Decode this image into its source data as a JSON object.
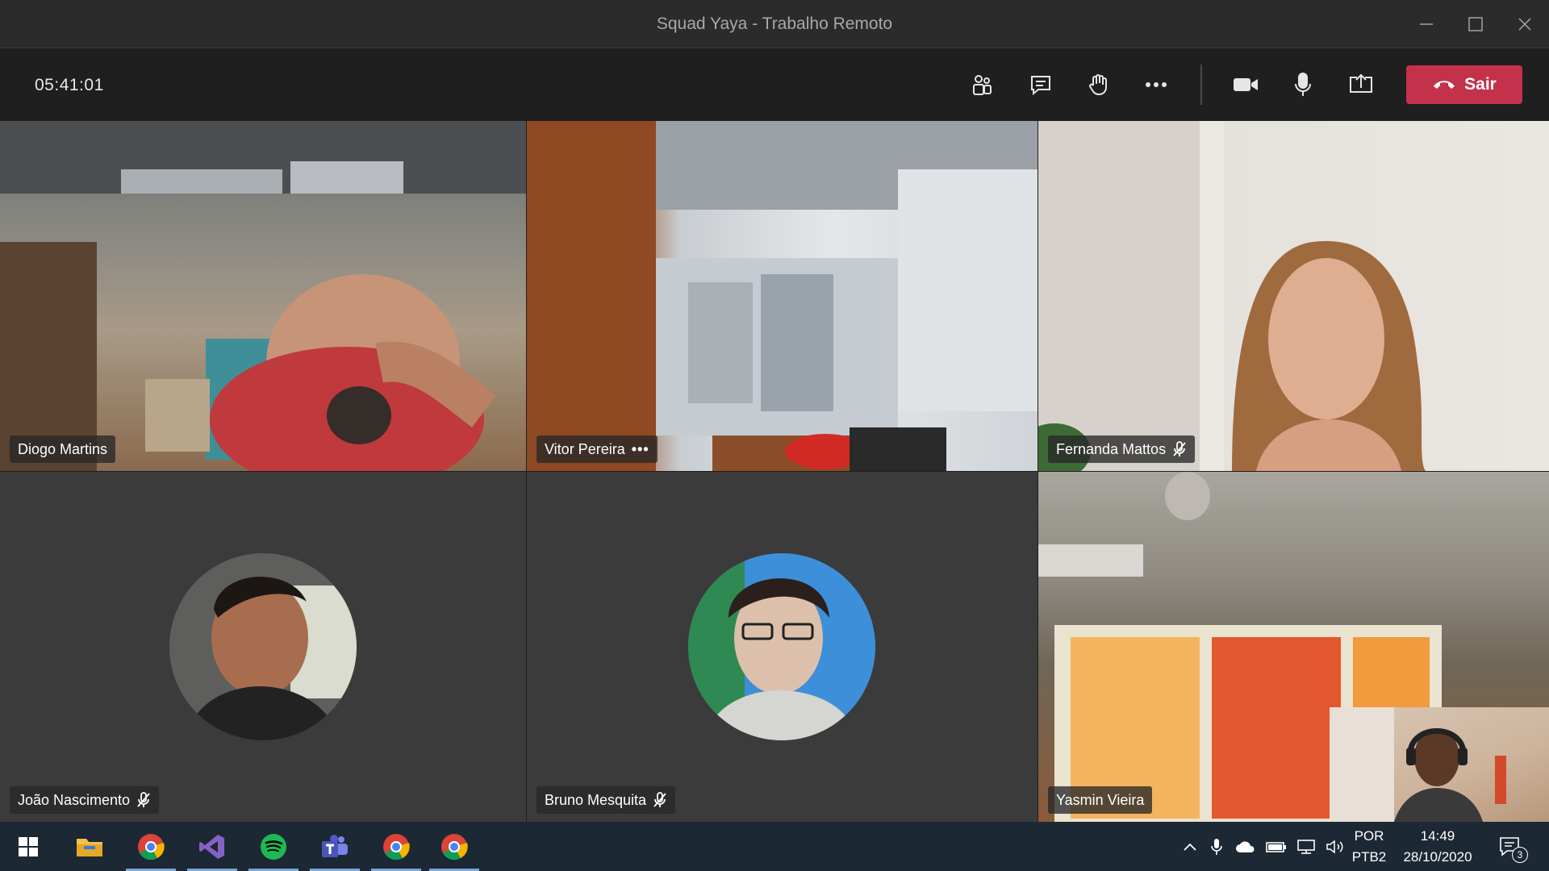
{
  "window": {
    "title": "Squad Yaya - Trabalho Remoto",
    "controls": [
      "minimize-icon",
      "maximize-icon",
      "close-icon"
    ]
  },
  "toolbar": {
    "timer": "05:41:01",
    "buttons": [
      "people-icon",
      "chat-icon",
      "raise-hand-icon",
      "more-options-icon",
      "camera-icon",
      "microphone-icon",
      "share-screen-icon"
    ],
    "leave_label": "Sair",
    "leave_color": "#c4314b"
  },
  "participants": [
    {
      "name": "Diogo Martins",
      "muted": false
    },
    {
      "name": "Vitor Pereira",
      "muted": false,
      "more": "•••"
    },
    {
      "name": "Fernanda Mattos",
      "muted": true
    },
    {
      "name": "João Nascimento",
      "muted": true
    },
    {
      "name": "Bruno Mesquita",
      "muted": true
    },
    {
      "name": "Yasmin Vieira",
      "muted": false
    }
  ],
  "taskbar": {
    "apps": [
      "windows-start-icon",
      "file-explorer-icon",
      "chrome-icon",
      "visual-studio-icon",
      "spotify-icon",
      "teams-icon",
      "chrome-icon",
      "chrome-icon"
    ],
    "language": "POR",
    "layout": "PTB2",
    "time": "14:49",
    "date": "28/10/2020",
    "notifications": "3"
  }
}
